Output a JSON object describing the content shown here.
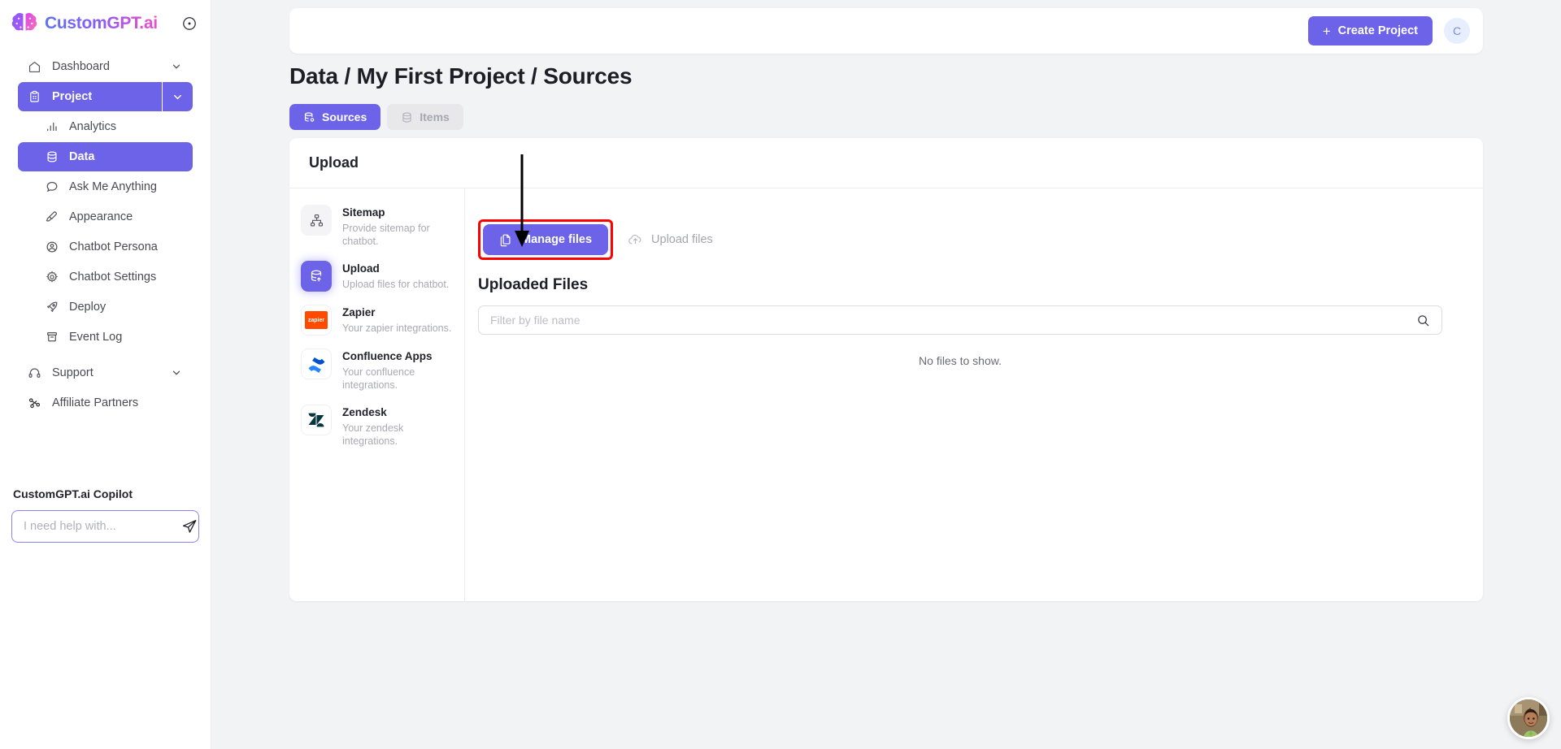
{
  "brand": {
    "name": "CustomGPT.ai",
    "logo_icon": "brain-icon",
    "collapse_icon": "collapse-circle-icon"
  },
  "sidebar": {
    "items": [
      {
        "label": "Dashboard",
        "icon": "home-icon",
        "level": "top",
        "active": false,
        "chevron": true
      },
      {
        "label": "Project",
        "icon": "clipboard-icon",
        "level": "top",
        "active": true,
        "chevron": true
      },
      {
        "label": "Analytics",
        "icon": "bar-chart-icon",
        "level": "sub",
        "active": false,
        "chevron": false
      },
      {
        "label": "Data",
        "icon": "database-icon",
        "level": "sub",
        "active": true,
        "chevron": false
      },
      {
        "label": "Ask Me Anything",
        "icon": "chat-bubble-icon",
        "level": "sub",
        "active": false,
        "chevron": false
      },
      {
        "label": "Appearance",
        "icon": "paintbrush-icon",
        "level": "sub",
        "active": false,
        "chevron": false
      },
      {
        "label": "Chatbot Persona",
        "icon": "user-circle-icon",
        "level": "sub",
        "active": false,
        "chevron": false
      },
      {
        "label": "Chatbot Settings",
        "icon": "gear-icon",
        "level": "sub",
        "active": false,
        "chevron": false
      },
      {
        "label": "Deploy",
        "icon": "rocket-icon",
        "level": "sub",
        "active": false,
        "chevron": false
      },
      {
        "label": "Event Log",
        "icon": "archive-icon",
        "level": "sub",
        "active": false,
        "chevron": false
      },
      {
        "label": "Support",
        "icon": "headset-icon",
        "level": "top2",
        "active": false,
        "chevron": true
      },
      {
        "label": "Affiliate Partners",
        "icon": "share-nodes-icon",
        "level": "top2",
        "active": false,
        "chevron": false
      }
    ],
    "copilot": {
      "title": "CustomGPT.ai Copilot",
      "placeholder": "I need help with...",
      "value": "",
      "send_icon": "send-plane-icon"
    }
  },
  "topbar": {
    "create_project_label": "Create Project",
    "create_project_icon": "plus-icon",
    "avatar_initial": "C"
  },
  "page": {
    "title": "Data / My First Project / Sources",
    "tabs": [
      {
        "label": "Sources",
        "icon": "database-gear-icon",
        "active": true
      },
      {
        "label": "Items",
        "icon": "database-icon",
        "active": false
      }
    ]
  },
  "panel": {
    "header": "Upload",
    "sources": [
      {
        "name": "Sitemap",
        "desc": "Provide sitemap for chatbot.",
        "icon": "sitemap-icon",
        "selected": false
      },
      {
        "name": "Upload",
        "desc": "Upload files for chatbot.",
        "icon": "database-upload-icon",
        "selected": true
      },
      {
        "name": "Zapier",
        "desc": "Your zapier integrations.",
        "icon": "zapier-logo-icon",
        "selected": false
      },
      {
        "name": "Confluence Apps",
        "desc": "Your confluence integrations.",
        "icon": "confluence-logo-icon",
        "selected": false
      },
      {
        "name": "Zendesk",
        "desc": "Your zendesk integrations.",
        "icon": "zendesk-logo-icon",
        "selected": false
      }
    ],
    "actions": {
      "manage_files_label": "Manage files",
      "manage_files_icon": "copy-files-icon",
      "upload_files_label": "Upload files",
      "upload_files_icon": "cloud-upload-icon"
    },
    "uploaded_title": "Uploaded Files",
    "filter_placeholder": "Filter by file name",
    "filter_value": "",
    "search_icon": "search-icon",
    "empty_message": "No files to show."
  },
  "annotation": {
    "arrow": "down-arrow-pointing-to-manage-files",
    "highlight_color": "#fe0000"
  },
  "chat_widget": {
    "avatar": "support-agent-avatar"
  },
  "colors": {
    "accent": "#6c63e8",
    "page_bg": "#f2f3f5",
    "card_bg": "#ffffff",
    "highlight": "#fe0000"
  }
}
